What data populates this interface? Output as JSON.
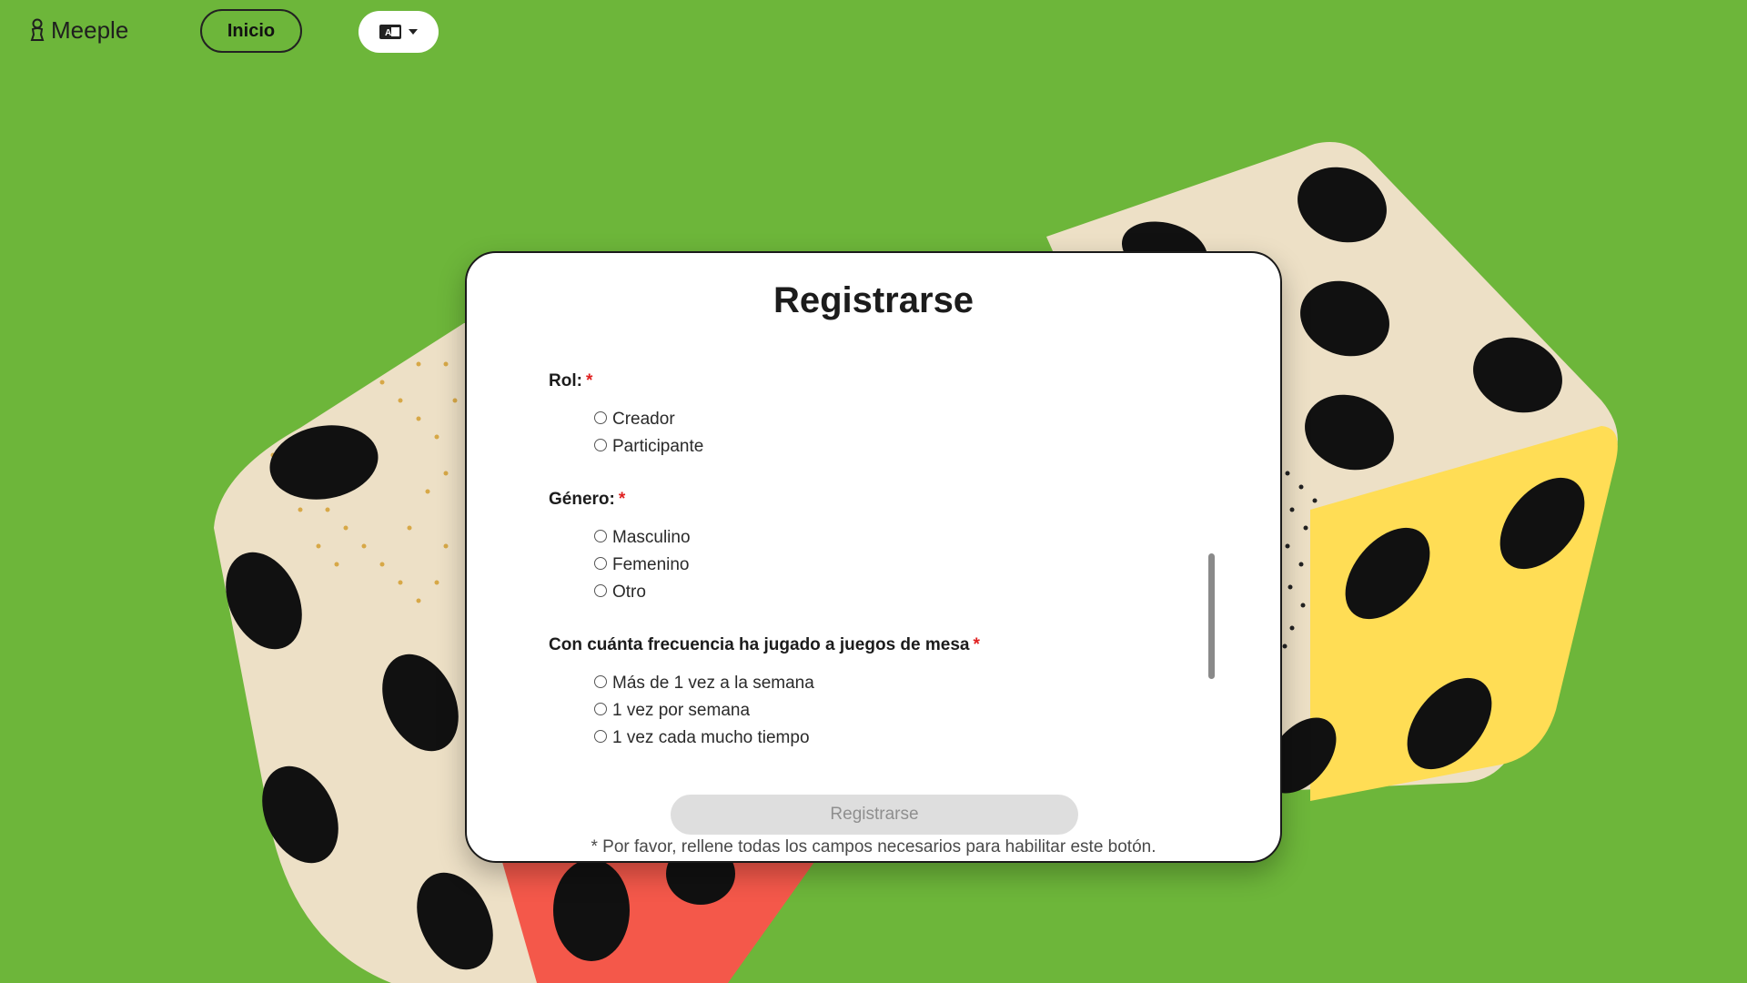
{
  "nav": {
    "brand": "Meeple",
    "home_label": "Inicio",
    "language_icon": "language-icon"
  },
  "form": {
    "title": "Registrarse",
    "questions": [
      {
        "label": "Rol:",
        "required": "*",
        "options": [
          "Creador",
          "Participante"
        ]
      },
      {
        "label": "Género:",
        "required": "*",
        "options": [
          "Masculino",
          "Femenino",
          "Otro"
        ]
      },
      {
        "label": "Con cuánta frecuencia ha jugado a juegos de mesa",
        "required": "*",
        "options": [
          "Más de 1 vez a la semana",
          "1 vez por semana",
          "1 vez cada mucho tiempo"
        ]
      }
    ],
    "submit_label": "Registrarse",
    "hint": "* Por favor, rellene todas los campos necesarios para habilitar este botón."
  },
  "colors": {
    "background": "#6db63a",
    "required_asterisk": "#e02020",
    "die_cream": "#ede0c6",
    "die_yellow": "#ffdd55",
    "die_red": "#f4584a"
  }
}
